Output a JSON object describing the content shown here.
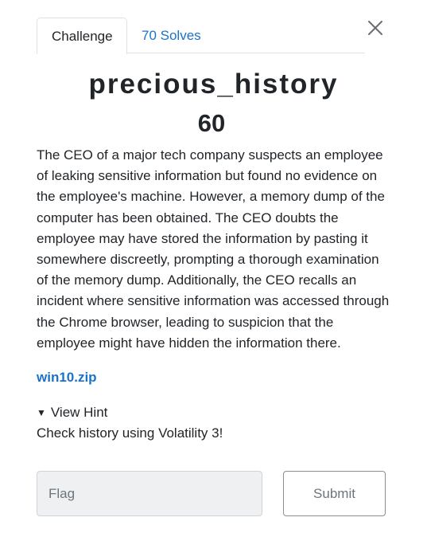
{
  "tabs": [
    {
      "label": "Challenge",
      "active": true
    },
    {
      "label": "70 Solves",
      "active": false
    }
  ],
  "challenge": {
    "name": "precious_history",
    "points": "60",
    "description": "The CEO of a major tech company suspects an employee of leaking sensitive information but found no evidence on the employee's machine. However, a memory dump of the computer has been obtained. The CEO doubts the employee may have stored the information by pasting it somewhere discreetly, prompting a thorough examination of the memory dump. Additionally, the CEO recalls an incident where sensitive information was accessed through the Chrome browser, leading to suspicion that the employee might have hidden the information there.",
    "file_link": "win10.zip",
    "hint_toggle_label": "View Hint",
    "hint_text": "Check history using Volatility 3!"
  },
  "form": {
    "flag_placeholder": "Flag",
    "flag_value": "",
    "submit_label": "Submit"
  },
  "icons": {
    "close": "close-icon",
    "hint_caret": "caret-down-icon"
  },
  "colors": {
    "link": "#1a73c8",
    "text": "#212529",
    "border": "#dee2e6"
  }
}
